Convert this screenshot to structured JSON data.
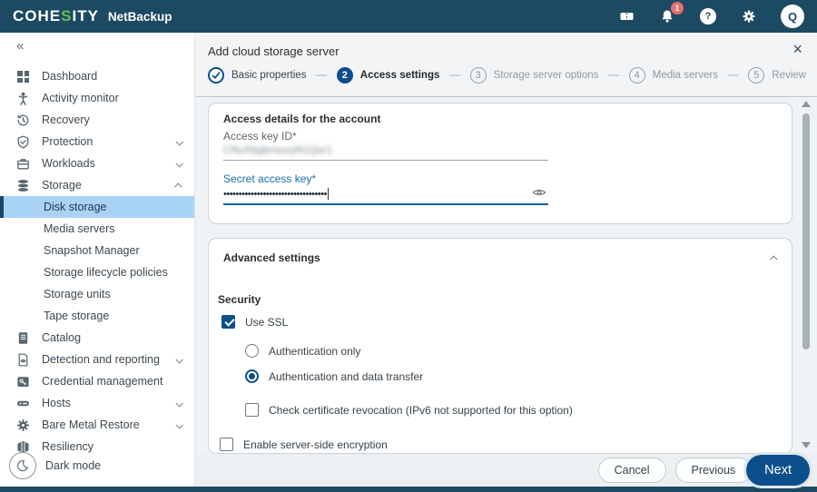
{
  "topbar": {
    "brand_prefix": "COHE",
    "brand_highlight": "S",
    "brand_suffix": "ITY",
    "product": "NetBackup",
    "notification_count": "1",
    "help_glyph": "?",
    "avatar_initial": "Q"
  },
  "sidebar": {
    "collapse_glyph": "«",
    "items": [
      {
        "label": "Dashboard"
      },
      {
        "label": "Activity monitor"
      },
      {
        "label": "Recovery"
      },
      {
        "label": "Protection",
        "expandable": true
      },
      {
        "label": "Workloads",
        "expandable": true
      },
      {
        "label": "Storage",
        "expandable": true,
        "expanded": true
      },
      {
        "label": "Disk storage",
        "selected": true
      },
      {
        "label": "Media servers"
      },
      {
        "label": "Snapshot Manager"
      },
      {
        "label": "Storage lifecycle policies"
      },
      {
        "label": "Storage units"
      },
      {
        "label": "Tape storage"
      },
      {
        "label": "Catalog"
      },
      {
        "label": "Detection and reporting",
        "expandable": true
      },
      {
        "label": "Credential management"
      },
      {
        "label": "Hosts",
        "expandable": true
      },
      {
        "label": "Bare Metal Restore",
        "expandable": true
      },
      {
        "label": "Resiliency"
      }
    ],
    "dark_mode_label": "Dark mode"
  },
  "wizard": {
    "title": "Add cloud storage server",
    "close_glyph": "×",
    "steps": [
      {
        "label": "Basic properties",
        "state": "done"
      },
      {
        "label": "Access settings",
        "state": "active",
        "number": "2"
      },
      {
        "label": "Storage server options",
        "state": "pending",
        "number": "3"
      },
      {
        "label": "Media servers",
        "state": "pending",
        "number": "4"
      },
      {
        "label": "Review",
        "state": "pending",
        "number": "5"
      }
    ]
  },
  "form": {
    "access": {
      "heading": "Access details for the account",
      "key_id_label": "Access key ID*",
      "key_id_value": "CNuXttglersucyN1Qur1",
      "secret_label": "Secret access key*",
      "secret_masked": "••••••••••••••••••••••••••••••••••"
    },
    "advanced": {
      "heading": "Advanced settings",
      "security_heading": "Security",
      "use_ssl_label": "Use SSL",
      "use_ssl_checked": true,
      "auth_only_label": "Authentication only",
      "auth_data_label": "Authentication and data transfer",
      "auth_selected": "Authentication and data transfer",
      "cert_revocation_label": "Check certificate revocation (IPv6 not supported for this option)",
      "cert_revocation_checked": false,
      "sse_label": "Enable server-side encryption",
      "sse_checked": false
    }
  },
  "footer": {
    "cancel_label": "Cancel",
    "previous_label": "Previous",
    "next_label": "Next"
  },
  "colors": {
    "topbar_bg": "#1d4a63",
    "accent_blue": "#0d4e8c",
    "brand_green": "#6abf4b",
    "selected_item_bg": "#a9d3f5",
    "badge_red": "#ea6d6d",
    "focus_label_blue": "#1a6fae"
  }
}
